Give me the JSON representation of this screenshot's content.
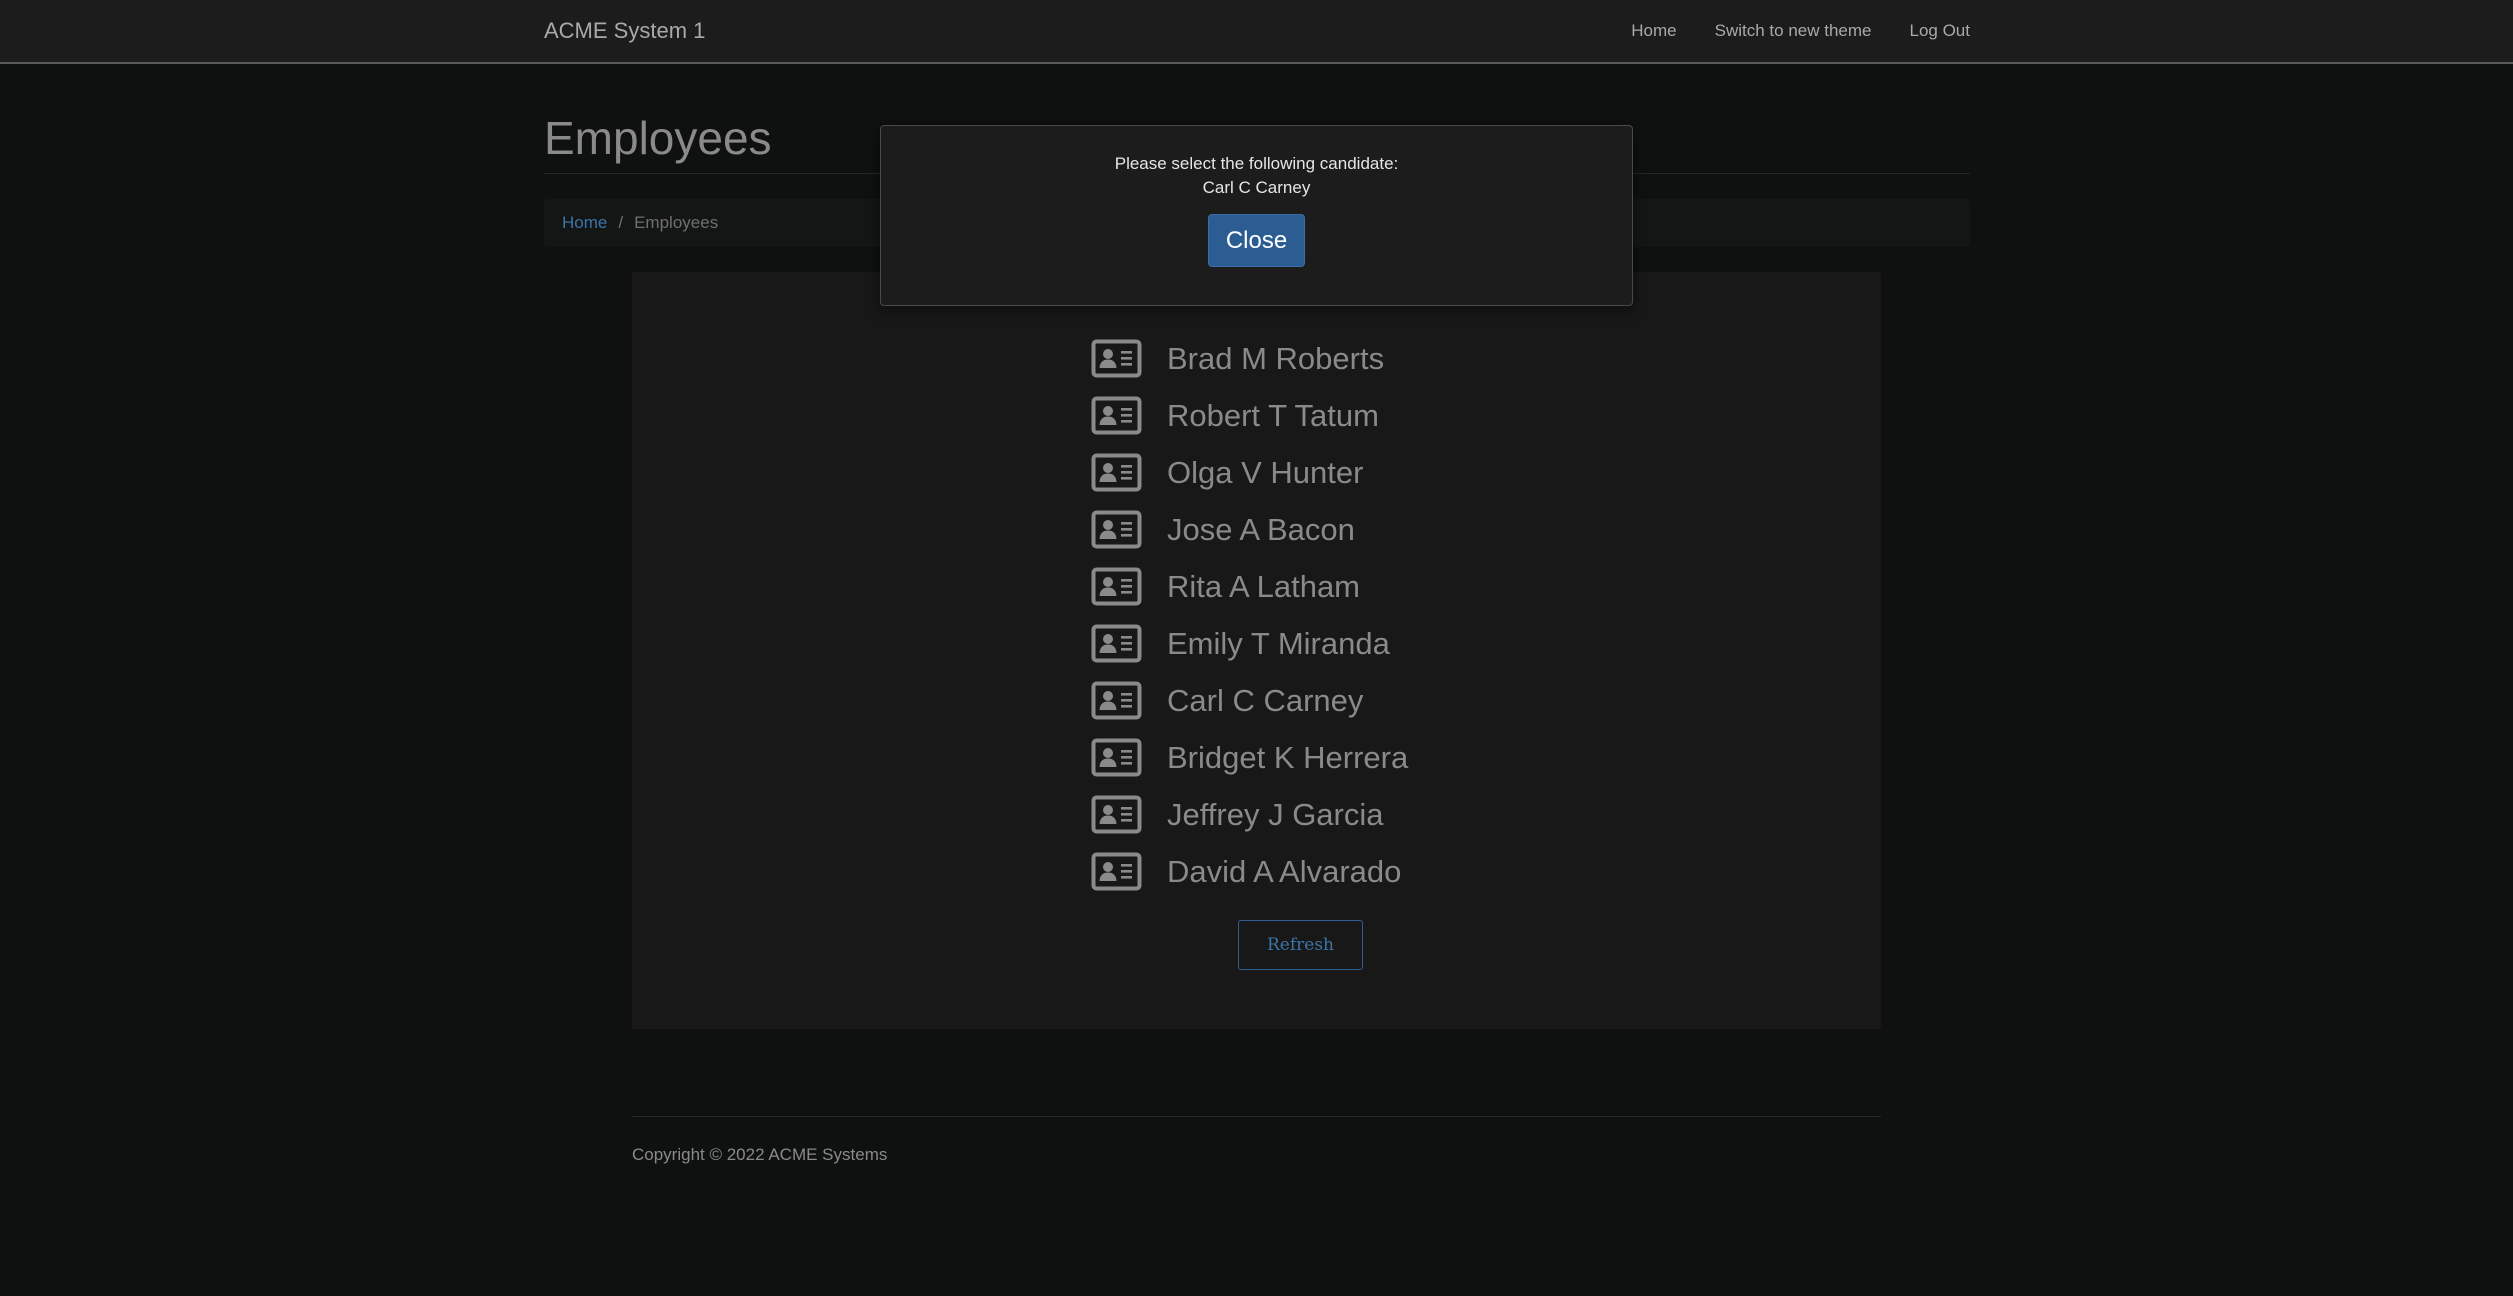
{
  "navbar": {
    "brand": "ACME System 1",
    "links": [
      "Home",
      "Switch to new theme",
      "Log Out"
    ]
  },
  "page": {
    "title": "Employees"
  },
  "breadcrumb": {
    "home": "Home",
    "separator": "/",
    "current": "Employees"
  },
  "employees": {
    "icon": "id-card-icon",
    "items": [
      "Brad M Roberts",
      "Robert T Tatum",
      "Olga V Hunter",
      "Jose A Bacon",
      "Rita A Latham",
      "Emily T Miranda",
      "Carl C Carney",
      "Bridget K Herrera",
      "Jeffrey J Garcia",
      "David A Alvarado"
    ],
    "refresh_label": "Refresh"
  },
  "footer": {
    "copyright": "Copyright © 2022 ACME Systems"
  },
  "modal": {
    "message": "Please select the following candidate:",
    "candidate": "Carl C Carney",
    "close_label": "Close"
  },
  "colors": {
    "background": "#0f1010",
    "navbar": "#1c1c1c",
    "panel": "#181818",
    "link_blue": "#3b74a8",
    "primary_button": "#2b5d92",
    "text_muted": "#8a8a8a"
  }
}
